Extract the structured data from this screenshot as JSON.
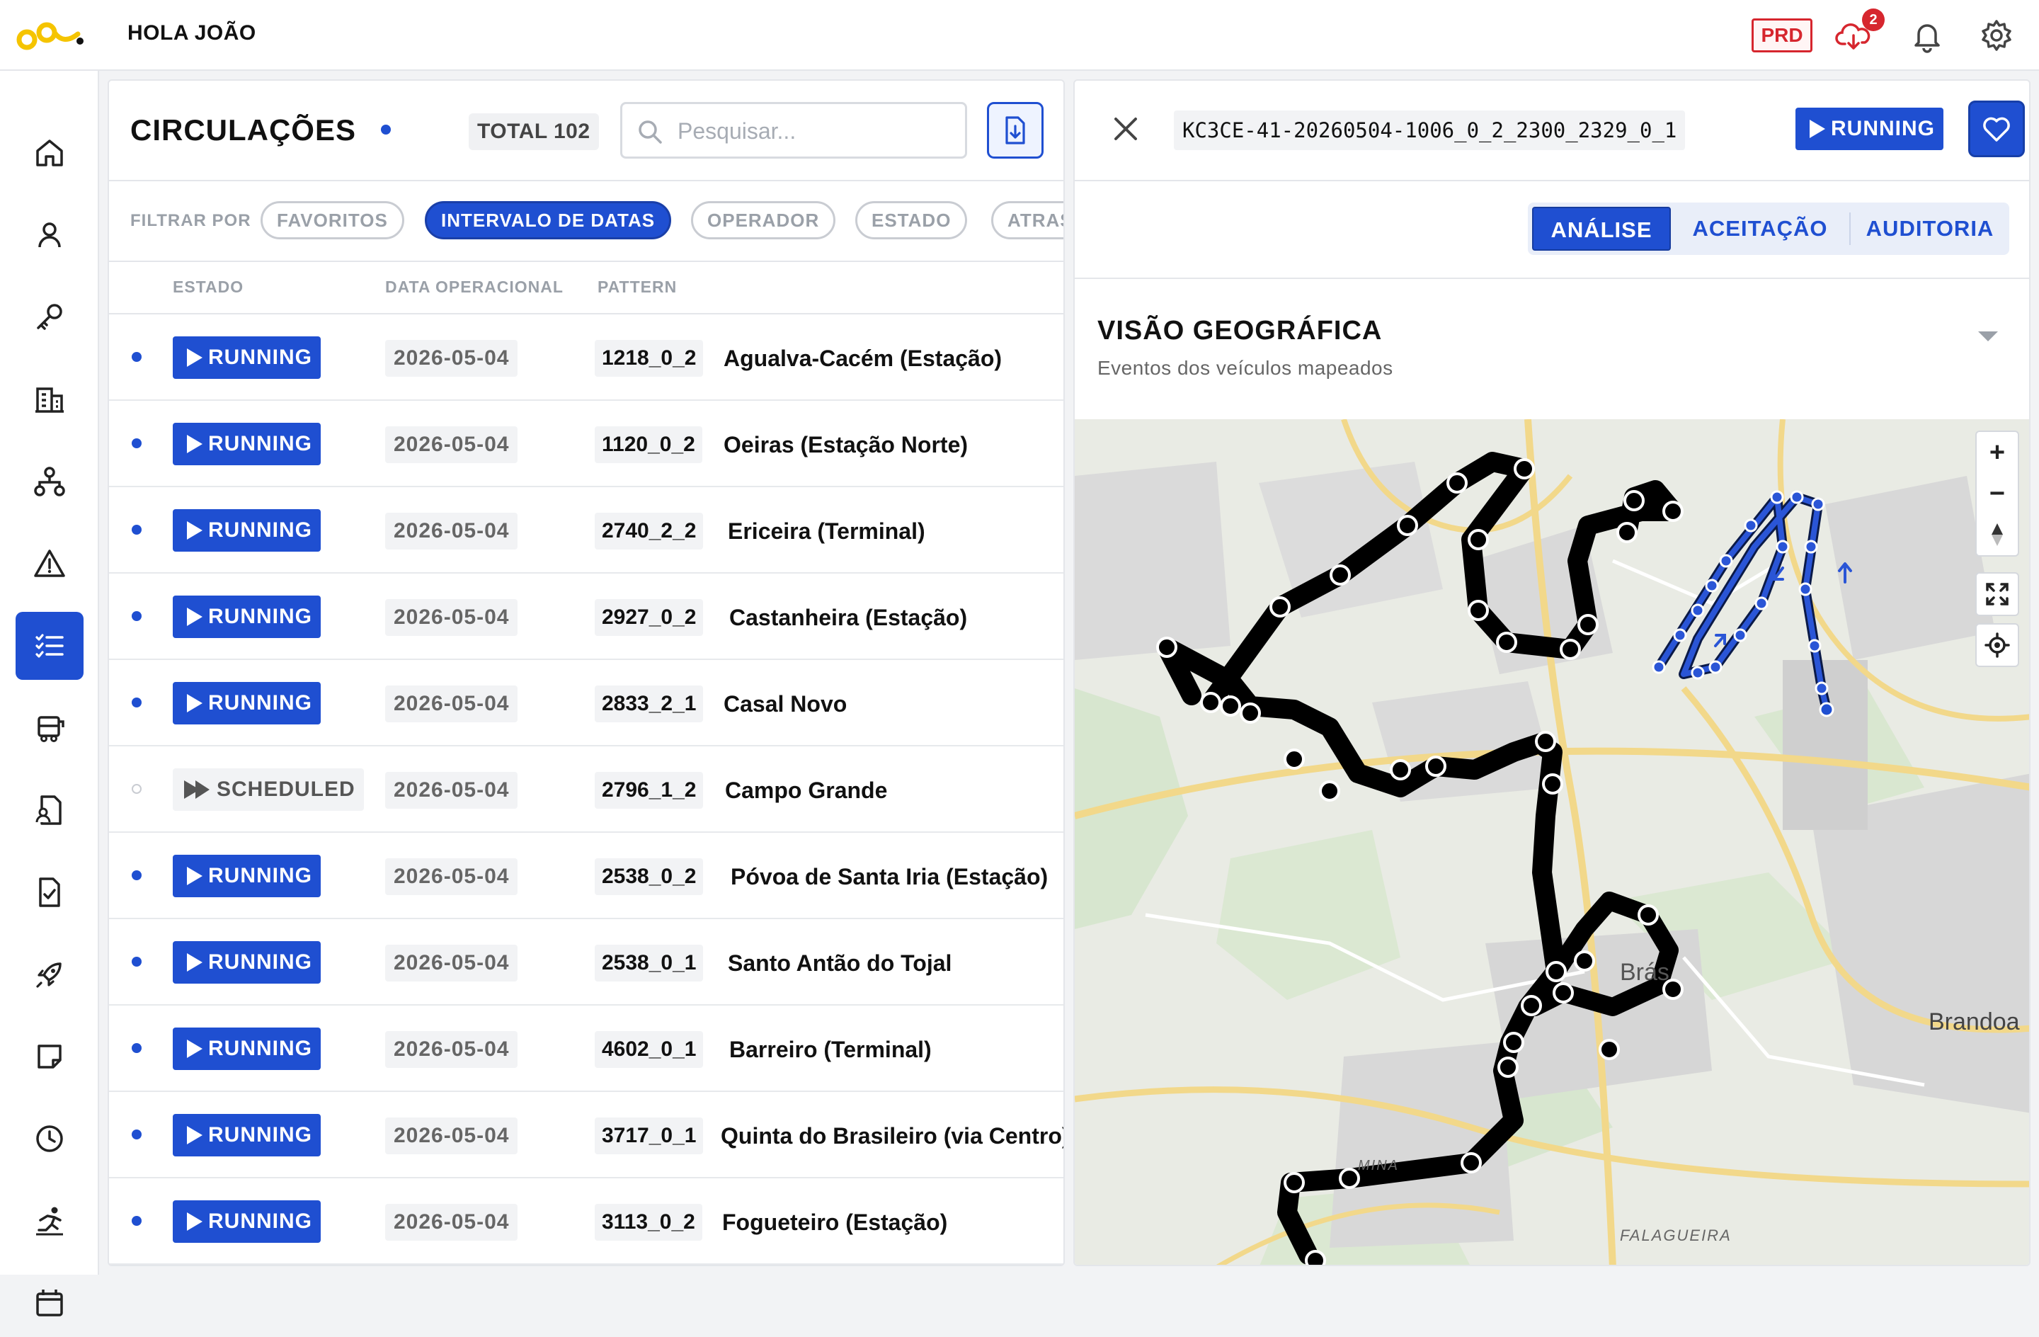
{
  "topbar": {
    "greeting": "HOLA JOÃO",
    "environment": "PRD",
    "notification_count": "2"
  },
  "sidebar": {
    "items": [
      {
        "icon": "home-icon",
        "active": false
      },
      {
        "icon": "user-icon",
        "active": false
      },
      {
        "icon": "key-icon",
        "active": false
      },
      {
        "icon": "building-icon",
        "active": false
      },
      {
        "icon": "network-icon",
        "active": false
      },
      {
        "icon": "alert-triangle-icon",
        "active": false
      },
      {
        "icon": "checklist-icon",
        "active": true
      },
      {
        "icon": "bus-icon",
        "active": false
      },
      {
        "icon": "user-document-icon",
        "active": false
      },
      {
        "icon": "document-check-icon",
        "active": false
      },
      {
        "icon": "rocket-icon",
        "active": false
      },
      {
        "icon": "sticky-note-icon",
        "active": false
      },
      {
        "icon": "clock-icon",
        "active": false
      },
      {
        "icon": "runner-icon",
        "active": false
      },
      {
        "icon": "calendar-icon",
        "active": false
      }
    ]
  },
  "list": {
    "title": "CIRCULAÇÕES",
    "total": "TOTAL 102",
    "search_placeholder": "Pesquisar...",
    "filter_label": "FILTRAR POR",
    "filters": [
      "FAVORITOS",
      "INTERVALO DE DATAS",
      "OPERADOR",
      "ESTADO",
      "ATRAS"
    ],
    "columns": {
      "status": "ESTADO",
      "date": "DATA OPERACIONAL",
      "pattern": "PATTERN"
    },
    "rows": [
      {
        "status": "RUNNING",
        "date": "2026-05-04",
        "pattern": "1218_0_2",
        "name": "Agualva-Cacém (Estação)"
      },
      {
        "status": "RUNNING",
        "date": "2026-05-04",
        "pattern": "1120_0_2",
        "name": "Oeiras (Estação Norte)"
      },
      {
        "status": "RUNNING",
        "date": "2026-05-04",
        "pattern": "2740_2_2",
        "name": "Ericeira (Terminal)"
      },
      {
        "status": "RUNNING",
        "date": "2026-05-04",
        "pattern": "2927_0_2",
        "name": "Castanheira (Estação)"
      },
      {
        "status": "RUNNING",
        "date": "2026-05-04",
        "pattern": "2833_2_1",
        "name": "Casal Novo"
      },
      {
        "status": "SCHEDULED",
        "date": "2026-05-04",
        "pattern": "2796_1_2",
        "name": "Campo Grande"
      },
      {
        "status": "RUNNING",
        "date": "2026-05-04",
        "pattern": "2538_0_2",
        "name": "Póvoa de Santa Iria (Estação)"
      },
      {
        "status": "RUNNING",
        "date": "2026-05-04",
        "pattern": "2538_0_1",
        "name": "Santo Antão do Tojal"
      },
      {
        "status": "RUNNING",
        "date": "2026-05-04",
        "pattern": "4602_0_1",
        "name": "Barreiro (Terminal)"
      },
      {
        "status": "RUNNING",
        "date": "2026-05-04",
        "pattern": "3717_0_1",
        "name": "Quinta do Brasileiro (via Centro)"
      },
      {
        "status": "RUNNING",
        "date": "2026-05-04",
        "pattern": "3113_0_2",
        "name": "Fogueteiro (Estação)"
      }
    ]
  },
  "detail": {
    "trip_id": "KC3CE-41-20260504-1006_0_2_2300_2329_0_1",
    "status": "RUNNING",
    "tabs": [
      "ANÁLISE",
      "ACEITAÇÃO",
      "AUDITORIA"
    ],
    "active_tab": "ANÁLISE",
    "section_title": "VISÃO GEOGRÁFICA",
    "section_subtitle": "Eventos dos veículos mapeados",
    "map_labels": {
      "bras": "Brás",
      "brandoa": "Brandoa",
      "falagueira": "FALAGUEIRA",
      "mina": "MINA"
    },
    "map_controls": {
      "zoom_in": "+",
      "zoom_out": "−"
    }
  },
  "colors": {
    "accent": "#1f4fd1",
    "danger": "#d6262e",
    "route": "#000000",
    "route_live": "#2a55d6"
  }
}
